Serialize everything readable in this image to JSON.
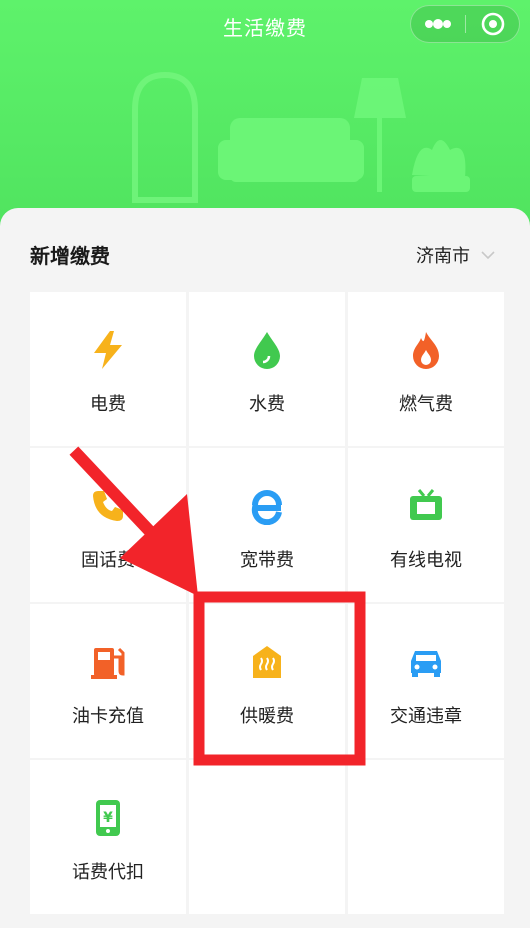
{
  "header": {
    "title": "生活缴费",
    "background_color": "#58ec67",
    "menu": [
      {
        "icon": "more-dots-icon"
      },
      {
        "icon": "close-circle-icon"
      }
    ]
  },
  "section": {
    "title": "新增缴费",
    "city": "济南市",
    "city_icon": "chevron-down-icon"
  },
  "services": [
    {
      "label": "电费",
      "icon": "lightning-icon",
      "color": "#f7b21b"
    },
    {
      "label": "水费",
      "icon": "water-drop-icon",
      "color": "#41c94f"
    },
    {
      "label": "燃气费",
      "icon": "flame-icon",
      "color": "#f26128"
    },
    {
      "label": "固话费",
      "icon": "phone-icon",
      "color": "#f7b21b"
    },
    {
      "label": "宽带费",
      "icon": "broadband-e-icon",
      "color": "#2a9df4"
    },
    {
      "label": "有线电视",
      "icon": "tv-icon",
      "color": "#41c94f"
    },
    {
      "label": "油卡充值",
      "icon": "fuel-pump-icon",
      "color": "#f26128"
    },
    {
      "label": "供暖费",
      "icon": "heating-house-icon",
      "color": "#f7b21b"
    },
    {
      "label": "交通违章",
      "icon": "car-icon",
      "color": "#2a9df4"
    },
    {
      "label": "话费代扣",
      "icon": "mobile-yuan-icon",
      "color": "#41c94f"
    }
  ],
  "annotation": {
    "color": "#f2242a",
    "elements": [
      "red-arrow",
      "highlight-box"
    ],
    "highlighted_item": "供暖费"
  }
}
